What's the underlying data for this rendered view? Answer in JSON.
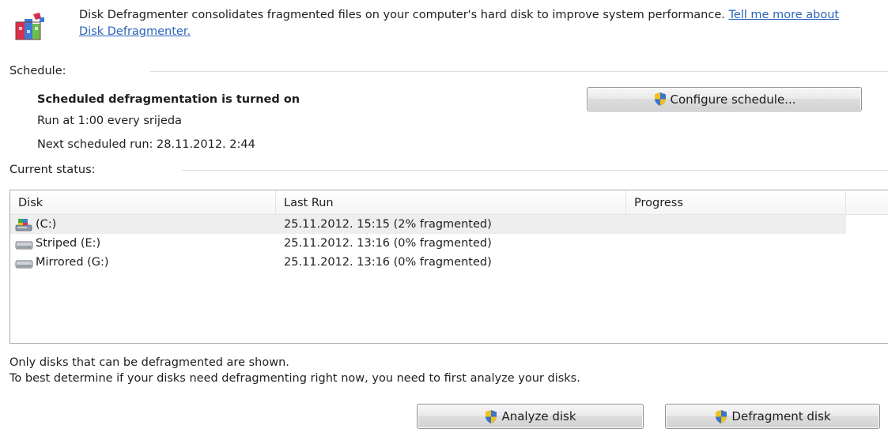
{
  "header": {
    "intro_text": "Disk Defragmenter consolidates fragmented files on your computer's hard disk to improve system performance.",
    "link_text": "Tell me more about Disk Defragmenter."
  },
  "schedule": {
    "section_label": "Schedule:",
    "status_title": "Scheduled defragmentation is turned on",
    "run_at": "Run at 1:00 every srijeda",
    "next_run": "Next scheduled run: 28.11.2012. 2:44",
    "configure_button": "Configure schedule..."
  },
  "status": {
    "section_label": "Current status:",
    "columns": [
      "Disk",
      "Last Run",
      "Progress"
    ],
    "rows": [
      {
        "disk": "(C:)",
        "last_run": "25.11.2012. 15:15 (2% fragmented)",
        "progress": "",
        "icon": "system-drive-icon",
        "selected": true
      },
      {
        "disk": "Striped (E:)",
        "last_run": "25.11.2012. 13:16 (0% fragmented)",
        "progress": "",
        "icon": "hard-drive-icon",
        "selected": false
      },
      {
        "disk": "Mirrored (G:)",
        "last_run": "25.11.2012. 13:16 (0% fragmented)",
        "progress": "",
        "icon": "hard-drive-icon",
        "selected": false
      }
    ]
  },
  "notes": {
    "line1": "Only disks that can be defragmented are shown.",
    "line2": "To best determine if your disks need defragmenting right now, you need to first analyze your disks."
  },
  "buttons": {
    "analyze": "Analyze disk",
    "defragment": "Defragment disk"
  },
  "colors": {
    "link": "#2a64b8",
    "selected_row": "#eeeeee",
    "shield_blue": "#3b73c8",
    "shield_yellow": "#f2c21a"
  }
}
